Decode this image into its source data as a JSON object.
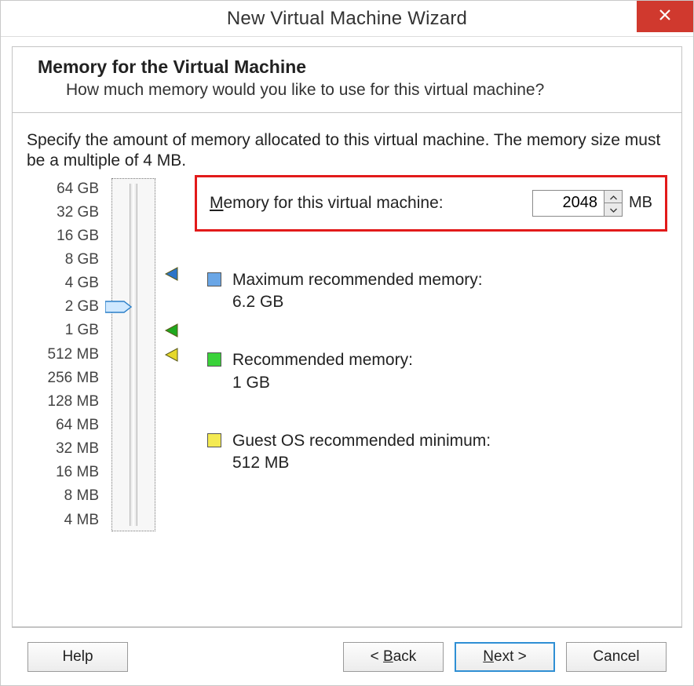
{
  "window": {
    "title": "New Virtual Machine Wizard"
  },
  "header": {
    "title": "Memory for the Virtual Machine",
    "subtitle": "How much memory would you like to use for this virtual machine?"
  },
  "instruction": "Specify the amount of memory allocated to this virtual machine. The memory size must be a multiple of 4 MB.",
  "memory_field": {
    "label_prefix": "M",
    "label_rest": "emory for this virtual machine:",
    "value": "2048",
    "unit": "MB"
  },
  "slider": {
    "ticks": [
      "64 GB",
      "32 GB",
      "16 GB",
      "8 GB",
      "4 GB",
      "2 GB",
      "1 GB",
      "512 MB",
      "256 MB",
      "128 MB",
      "64 MB",
      "32 MB",
      "16 MB",
      "8 MB",
      "4 MB"
    ],
    "thumb_index": 5,
    "markers": [
      {
        "index": 3.6,
        "color": "#2b74c8"
      },
      {
        "index": 6,
        "color": "#1ea81e"
      },
      {
        "index": 7,
        "color": "#e6d82a"
      }
    ]
  },
  "recommendations": [
    {
      "swatch": "#6aa6e6",
      "label": "Maximum recommended memory:",
      "value": "6.2 GB"
    },
    {
      "swatch": "#3ad23a",
      "label": "Recommended memory:",
      "value": "1 GB"
    },
    {
      "swatch": "#f4ea52",
      "label": "Guest OS recommended minimum:",
      "value": "512 MB"
    }
  ],
  "footer": {
    "help": "Help",
    "back_prefix": "< ",
    "back_ul": "B",
    "back_rest": "ack",
    "next_ul": "N",
    "next_rest": "ext >",
    "cancel": "Cancel"
  }
}
